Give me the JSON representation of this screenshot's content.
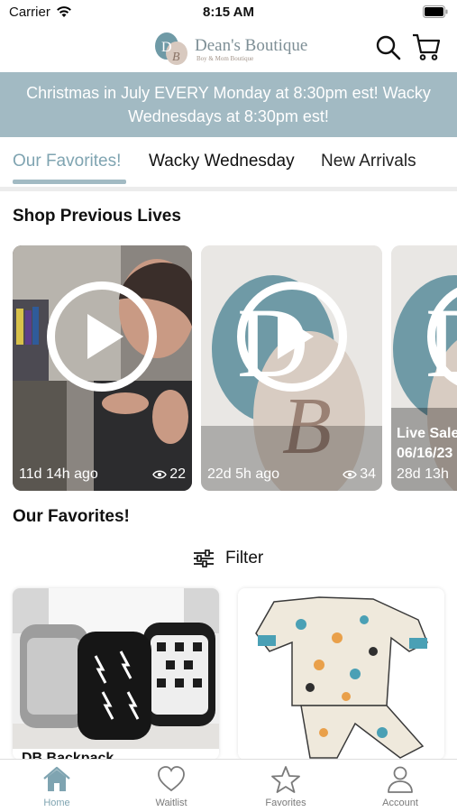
{
  "status_bar": {
    "carrier": "Carrier",
    "time": "8:15 AM"
  },
  "header": {
    "logo_text": "Dean's Boutique",
    "logo_subtitle": "Boy & Mom Boutique",
    "search_icon": "search-icon",
    "cart_icon": "cart-icon"
  },
  "banner": {
    "text": "Christmas in July EVERY Monday at 8:30pm est! Wacky Wednesdays at 8:30pm est!"
  },
  "tabs": [
    {
      "label": "Our Favorites!",
      "active": true
    },
    {
      "label": "Wacky Wednesday",
      "active": false
    },
    {
      "label": "New Arrivals",
      "active": false
    }
  ],
  "previous_lives": {
    "title": "Shop Previous Lives",
    "videos": [
      {
        "time_ago": "11d 14h ago",
        "views": "22"
      },
      {
        "time_ago": "22d 5h ago",
        "views": "34"
      },
      {
        "time_ago": "28d 13h",
        "live_title": "Live Sale",
        "live_date": "06/16/23"
      }
    ]
  },
  "favorites": {
    "title": "Our Favorites!",
    "filter_label": "Filter",
    "products": [
      {
        "title": "DB Backpack"
      },
      {
        "title": ""
      }
    ]
  },
  "tab_bar": [
    {
      "label": "Home",
      "icon": "home-icon",
      "active": true
    },
    {
      "label": "Waitlist",
      "icon": "heart-icon",
      "active": false
    },
    {
      "label": "Favorites",
      "icon": "star-icon",
      "active": false
    },
    {
      "label": "Account",
      "icon": "person-icon",
      "active": false
    }
  ],
  "colors": {
    "accent": "#a2bac3",
    "accent_text": "#7fa4b1",
    "logo_teal": "#6f9aa6"
  }
}
